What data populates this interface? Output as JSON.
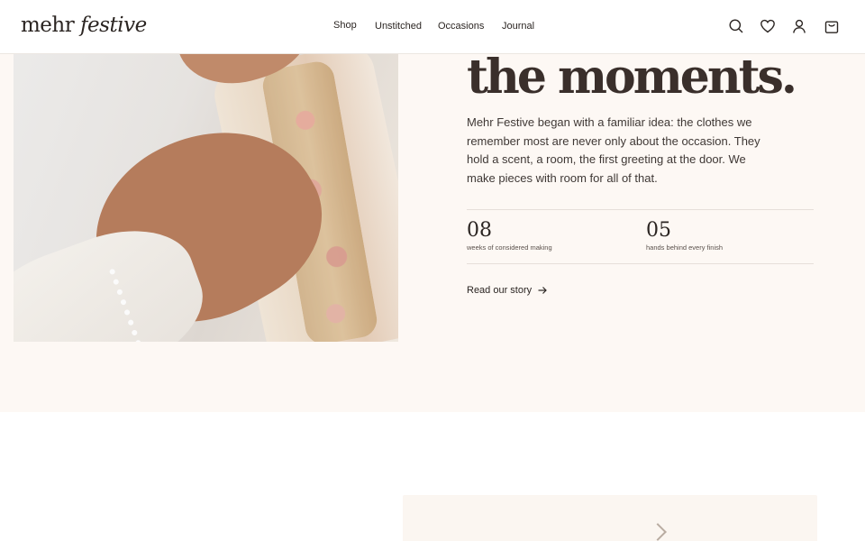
{
  "header": {
    "logo": {
      "part1": "mehr ",
      "part2": "festive"
    },
    "nav": [
      "Shop",
      "Unstitched",
      "Occasions",
      "Journal"
    ],
    "icons": [
      "search-icon",
      "heart-icon",
      "account-icon",
      "bag-icon"
    ]
  },
  "story": {
    "headline": "the moments.",
    "body": "Mehr Festive began with a familiar idea: the clothes we remember most are never only about the occasion. They hold a scent, a room, the first greeting at the door. We make pieces with room for all of that.",
    "stats": [
      {
        "number": "08",
        "label": "weeks of considered making"
      },
      {
        "number": "05",
        "label": "hands behind every finish"
      }
    ],
    "cta": {
      "label": "Read our story",
      "icon": "arrow-right-icon"
    }
  },
  "colors": {
    "section_background": "#fdf8f4",
    "text_primary": "#2b2522",
    "headline": "#3a2f2b"
  }
}
